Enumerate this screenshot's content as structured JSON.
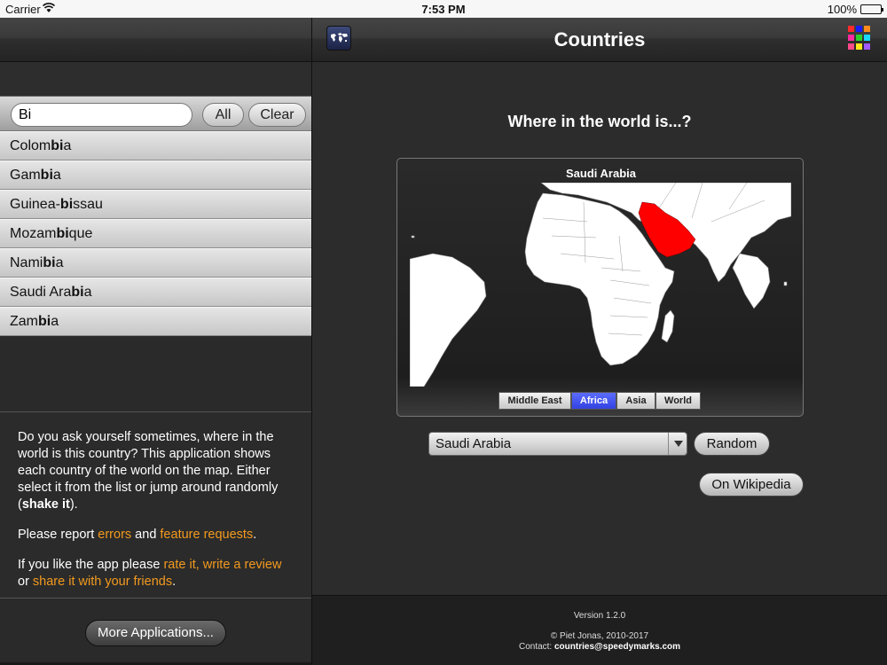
{
  "status_bar": {
    "carrier": "Carrier",
    "time": "7:53 PM",
    "battery": "100%"
  },
  "search": {
    "value": "Bi",
    "all_label": "All",
    "clear_label": "Clear"
  },
  "countries": [
    {
      "pre": "Colom",
      "match": "bi",
      "post": "a"
    },
    {
      "pre": "Gam",
      "match": "bi",
      "post": "a"
    },
    {
      "pre": "Guinea-",
      "match": "bi",
      "post": "ssau"
    },
    {
      "pre": "Mozam",
      "match": "bi",
      "post": "que"
    },
    {
      "pre": "Nami",
      "match": "bi",
      "post": "a"
    },
    {
      "pre": "Saudi Ara",
      "match": "bi",
      "post": "a"
    },
    {
      "pre": "Zam",
      "match": "bi",
      "post": "a"
    }
  ],
  "about": {
    "p1_a": "Do you ask yourself sometimes, where in the world is this country? This application shows each country of the world on the map. Either select it from the list or jump around randomly (",
    "p1_bold": "shake it",
    "p1_b": ").",
    "p2_a": "Please report ",
    "p2_link1": "errors",
    "p2_b": " and ",
    "p2_link2": "feature requests",
    "p2_c": ".",
    "p3_a": "If you like the app please ",
    "p3_link1": "rate it, write a review",
    "p3_b": " or ",
    "p3_link2": "share it with your friends",
    "p3_c": "."
  },
  "more_apps_label": "More Applications...",
  "header": {
    "title": "Countries"
  },
  "question": "Where in the world is...?",
  "map": {
    "country_label": "Saudi Arabia",
    "highlight_color": "#ff0000",
    "regions": [
      "Middle East",
      "Africa",
      "Asia",
      "World"
    ],
    "active_region": "Africa"
  },
  "selector": {
    "selected": "Saudi Arabia"
  },
  "random_label": "Random",
  "wikipedia_label": "On Wikipedia",
  "footer": {
    "version": "Version 1.2.0",
    "copyright": "© Piet Jonas, 2010-2017",
    "contact_label": "Contact: ",
    "contact_email": "countries@speedymarks.com"
  },
  "grid_colors": [
    "#ff2a2a",
    "#1a1aff",
    "#ff8a1a",
    "#ff2aa0",
    "#2ad12a",
    "#18d8ff",
    "#ff4a8a",
    "#ffe81a",
    "#a05aff"
  ]
}
